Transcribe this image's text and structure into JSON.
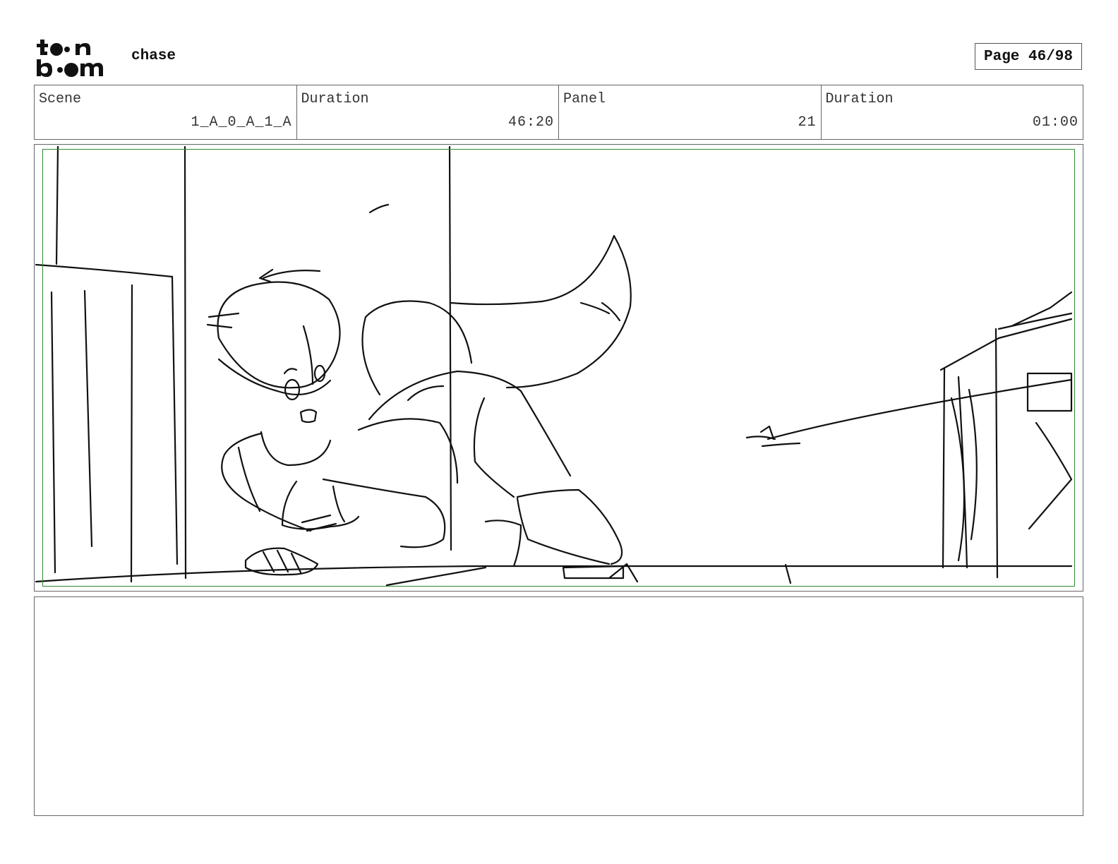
{
  "header": {
    "logo_text": "toon boom",
    "project_title": "chase",
    "page_label": "Page 46/98"
  },
  "info": {
    "scene_label": "Scene",
    "scene_value": "1_A_0_A_1_A",
    "scene_duration_label": "Duration",
    "scene_duration_value": "46:20",
    "panel_label": "Panel",
    "panel_value": "21",
    "panel_duration_label": "Duration",
    "panel_duration_value": "01:00"
  },
  "panel": {
    "safe_frame_color": "#2f8a2f",
    "image_description_icon": "rough-storyboard-sketch"
  },
  "notes": {
    "action_text": "",
    "dialogue_text": ""
  }
}
